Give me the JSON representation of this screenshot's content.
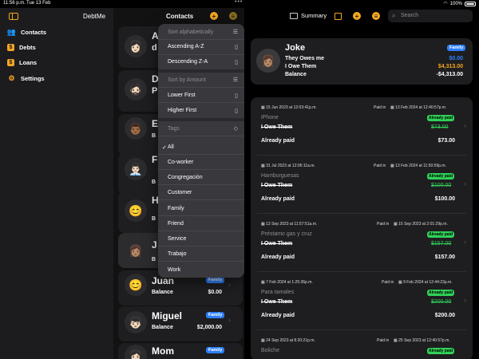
{
  "status": {
    "time": "11:56 p.m.",
    "date": "Tue 13 Feb",
    "battery": "100%"
  },
  "app": {
    "title": "DebtMe"
  },
  "sidebar": {
    "items": [
      {
        "label": "Contacts",
        "icon": "people-icon"
      },
      {
        "label": "Debts",
        "icon": "debts-icon"
      },
      {
        "label": "Loans",
        "icon": "loans-icon"
      },
      {
        "label": "Settings",
        "icon": "gear-icon"
      }
    ]
  },
  "contacts": {
    "title": "Contacts",
    "cards": [
      {
        "initial": "A",
        "second": "d",
        "avatar": "👩🏻"
      },
      {
        "initial": "D",
        "second": "P",
        "avatar": "🧔🏻"
      },
      {
        "initial": "E",
        "second": "B",
        "avatar": "👨🏾"
      },
      {
        "initial": "F",
        "second": "B",
        "avatar": "👨🏻‍💼"
      },
      {
        "initial": "H",
        "second": "B",
        "avatar": "😊"
      },
      {
        "initial": "J",
        "second": "B",
        "avatar": "👩🏽"
      },
      {
        "name": "Juan",
        "tag": "Family",
        "balance_label": "Balance",
        "balance": "$0.00",
        "avatar": "😊"
      },
      {
        "name": "Miguel",
        "tag": "Family",
        "balance_label": "Balance",
        "balance": "$2,000.00",
        "avatar": "👦🏻"
      },
      {
        "name": "Mom",
        "tag": "Family",
        "avatar": "👩🏻"
      }
    ]
  },
  "menu": {
    "sort_alpha_header": "Sort alphabetically",
    "ascending": "Ascending A-Z",
    "descending": "Descending Z-A",
    "sort_amount_header": "Sort by Amount",
    "lower_first": "Lower First",
    "higher_first": "Higher First",
    "tags_header": "Tags",
    "tags": [
      "All",
      "Co-worker",
      "Congregación",
      "Customer",
      "Family",
      "Friend",
      "Service",
      "Trabajo",
      "Work"
    ],
    "selected_tag": "All"
  },
  "toolbar": {
    "summary": "Summary",
    "search_placeholder": "Search"
  },
  "summary": {
    "name": "Joke",
    "tag": "Family",
    "they_owe_label": "They Owes me",
    "they_owe": "$0.00",
    "i_owe_label": "I Owe Them",
    "i_owe": "$4,313.00",
    "balance_label": "Balance",
    "balance": "-$4,313.00",
    "colors": {
      "they_owe": "#2d7ff9",
      "i_owe": "#f5a623"
    }
  },
  "debts": [
    {
      "date": "15 Jun 2023 at 12:03:41p.m.",
      "paid_in_label": "Paid in",
      "paid_date": "13 Feb 2024 at 12:40:57p.m.",
      "name": "iPhone",
      "badge": "Already paid",
      "type": "I Owe Them",
      "original": "$73.00",
      "paid_label": "Already paid",
      "paid": "$73.00"
    },
    {
      "date": "31 Jul 2023 at 12:06:11a.m.",
      "paid_in_label": "Paid in",
      "paid_date": "13 Feb 2024 at 11:50:59p.m.",
      "name": "Hamburguesas",
      "badge": "Already paid",
      "type": "I Owe Them",
      "original": "$100.00",
      "paid_label": "Already paid",
      "paid": "$100.00"
    },
    {
      "date": "13 Sep 2023 at 11:57:51a.m.",
      "paid_in_label": "Paid in",
      "paid_date": "15 Sep 2023 at 2:01:29p.m.",
      "name": "Préstamo gas y cruz",
      "badge": "Already paid",
      "type": "I Owe Them",
      "original": "$157.00",
      "paid_label": "Already paid",
      "paid": "$157.00"
    },
    {
      "date": "7 Feb 2024 at 1:25:36p.m.",
      "paid_in_label": "Paid in",
      "paid_date": "9 Feb 2024 at 12:44:23p.m.",
      "name": "Para tamales",
      "badge": "Already paid",
      "type": "I Owe Them",
      "original": "$200.00",
      "paid_label": "Already paid",
      "paid": "$200.00"
    },
    {
      "date": "24 Sep 2023 at 8:20:21p.m.",
      "paid_in_label": "Paid in",
      "paid_date": "25 Sep 2023 at 12:40:57p.m.",
      "name": "Boliche",
      "badge": "Already paid"
    }
  ]
}
